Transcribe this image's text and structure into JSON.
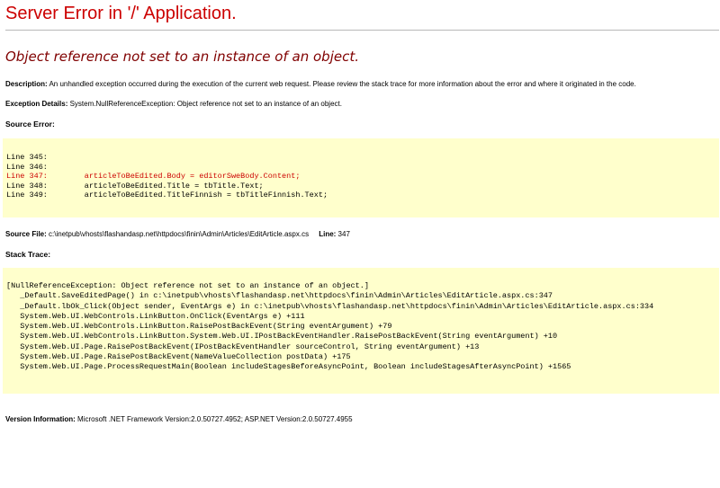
{
  "page": {
    "title": "Server Error in '/' Application.",
    "subtitle": "Object reference not set to an instance of an object."
  },
  "description": {
    "label": "Description:",
    "text": "An unhandled exception occurred during the execution of the current web request. Please review the stack trace for more information about the error and where it originated in the code."
  },
  "exception_details": {
    "label": "Exception Details:",
    "text": "System.NullReferenceException: Object reference not set to an instance of an object."
  },
  "source_error": {
    "label": "Source Error:",
    "lines": [
      {
        "text": "Line 345:",
        "highlight": false
      },
      {
        "text": "Line 346:",
        "highlight": false
      },
      {
        "text": "Line 347:        articleToBeEdited.Body = editorSweBody.Content;",
        "highlight": true
      },
      {
        "text": "Line 348:        articleToBeEdited.Title = tbTitle.Text;",
        "highlight": false
      },
      {
        "text": "Line 349:        articleToBeEdited.TitleFinnish = tbTitleFinnish.Text;",
        "highlight": false
      }
    ]
  },
  "source_file": {
    "label": "Source File:",
    "path": "c:\\inetpub\\vhosts\\flashandasp.net\\httpdocs\\finin\\Admin\\Articles\\EditArticle.aspx.cs",
    "line_label": "Line:",
    "line_number": "347"
  },
  "stack_trace": {
    "label": "Stack Trace:",
    "lines": [
      "[NullReferenceException: Object reference not set to an instance of an object.]",
      "   _Default.SaveEditedPage() in c:\\inetpub\\vhosts\\flashandasp.net\\httpdocs\\finin\\Admin\\Articles\\EditArticle.aspx.cs:347",
      "   _Default.lbOk_Click(Object sender, EventArgs e) in c:\\inetpub\\vhosts\\flashandasp.net\\httpdocs\\finin\\Admin\\Articles\\EditArticle.aspx.cs:334",
      "   System.Web.UI.WebControls.LinkButton.OnClick(EventArgs e) +111",
      "   System.Web.UI.WebControls.LinkButton.RaisePostBackEvent(String eventArgument) +79",
      "   System.Web.UI.WebControls.LinkButton.System.Web.UI.IPostBackEventHandler.RaisePostBackEvent(String eventArgument) +10",
      "   System.Web.UI.Page.RaisePostBackEvent(IPostBackEventHandler sourceControl, String eventArgument) +13",
      "   System.Web.UI.Page.RaisePostBackEvent(NameValueCollection postData) +175",
      "   System.Web.UI.Page.ProcessRequestMain(Boolean includeStagesBeforeAsyncPoint, Boolean includeStagesAfterAsyncPoint) +1565"
    ]
  },
  "version_info": {
    "label": "Version Information:",
    "text": "Microsoft .NET Framework Version:2.0.50727.4952; ASP.NET Version:2.0.50727.4955"
  },
  "colors": {
    "title": "#cc0000",
    "subtitle": "#800000",
    "code_background": "#ffffcc",
    "highlight_line": "#cc0000"
  }
}
